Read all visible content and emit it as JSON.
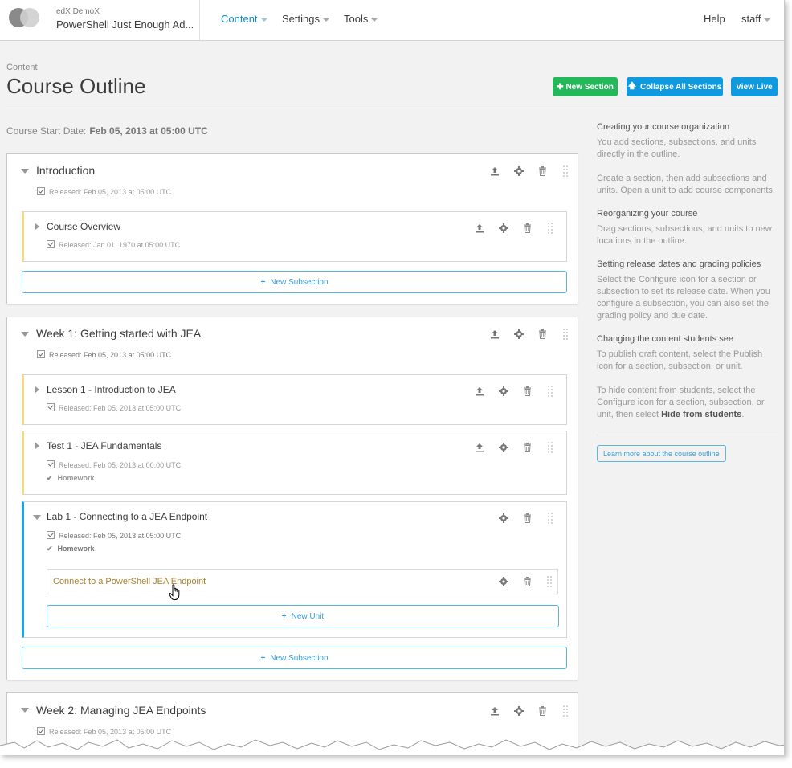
{
  "header": {
    "org": "edX DemoX",
    "course": "PowerShell Just Enough Ad...",
    "nav": [
      "Content",
      "Settings",
      "Tools"
    ],
    "help": "Help",
    "user": "staff"
  },
  "page": {
    "breadcrumb": "Content",
    "title": "Course Outline",
    "buttons": {
      "new_section": "New Section",
      "collapse": "Collapse All Sections",
      "view_live": "View Live"
    },
    "start_label": "Course Start Date:",
    "start_value": "Feb 05, 2013 at 05:00 UTC"
  },
  "sections": [
    {
      "title": "Introduction",
      "released": "Released: Feb 05, 2013 at 05:00 UTC",
      "subsections": [
        {
          "title": "Course Overview",
          "released": "Released: Jan 01, 1970 at 05:00 UTC"
        }
      ],
      "new_subsection": "New Subsection"
    },
    {
      "title": "Week 1: Getting started with JEA",
      "released": "Released: Feb 05, 2013 at 05:00 UTC",
      "subsections": [
        {
          "title": "Lesson 1 - Introduction to JEA",
          "released": "Released: Feb 05, 2013 at 05:00 UTC"
        },
        {
          "title": "Test 1 - JEA Fundamentals",
          "released": "Released: Feb 05, 2013 at 00:00 UTC",
          "grading": "Homework"
        },
        {
          "title": "Lab 1 - Connecting to a JEA Endpoint",
          "released": "Released: Feb 05, 2013 at 05:00 UTC",
          "grading": "Homework",
          "units": [
            "Connect to a PowerShell JEA Endpoint"
          ],
          "new_unit": "New Unit"
        }
      ],
      "new_subsection": "New Subsection"
    },
    {
      "title": "Week 2: Managing JEA Endpoints",
      "released": "Released: Feb 05, 2013 at 05:00 UTC"
    }
  ],
  "sidebar": {
    "h1": "Creating your course organization",
    "p1": "You add sections, subsections, and units directly in the outline.",
    "p2": "Create a section, then add subsections and units. Open a unit to add course components.",
    "h2": "Reorganizing your course",
    "p3": "Drag sections, subsections, and units to new locations in the outline.",
    "h3": "Setting release dates and grading policies",
    "p4": "Select the Configure icon for a section or subsection to set its release date. When you configure a subsection, you can also set the grading policy and due date.",
    "h4": "Changing the content students see",
    "p5": "To publish draft content, select the Publish icon for a section, subsection, or unit.",
    "p6a": "To hide content from students, select the Configure icon for a section, subsection, or unit, then select ",
    "p6b": "Hide from students",
    "p6c": ".",
    "learn": "Learn more about the course outline"
  },
  "colors": {
    "accent": "#0f9ae0",
    "green": "#25b85a",
    "subsection_border": "#f5d78b",
    "open_border": "#1ca3e6",
    "unit_link": "#a9822e"
  },
  "icons": [
    "publish-icon",
    "gear-icon",
    "trash-icon",
    "drag-handle-icon",
    "plus-icon",
    "checkmark-icon"
  ]
}
